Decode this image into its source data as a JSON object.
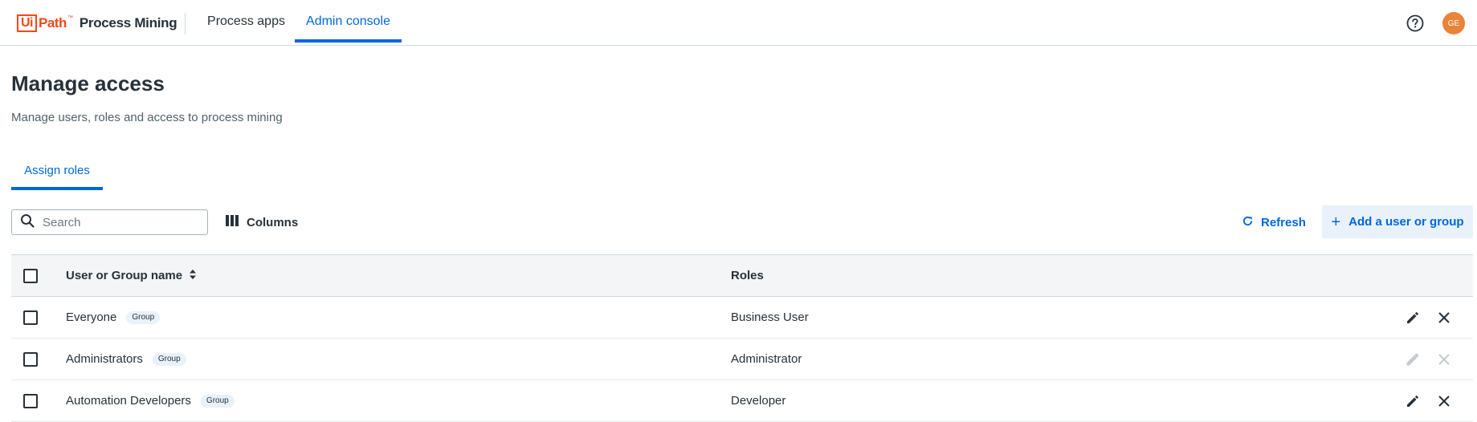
{
  "header": {
    "logo_mark": "Ui",
    "logo_path": "Path",
    "logo_tm": "™",
    "product_name": "Process Mining",
    "nav": [
      {
        "label": "Process apps",
        "active": false
      },
      {
        "label": "Admin console",
        "active": true
      }
    ],
    "help_icon": "help-circle-icon",
    "avatar_initials": "GE",
    "avatar_color": "#e8833a"
  },
  "page": {
    "title": "Manage access",
    "subtitle": "Manage users, roles and access to process mining"
  },
  "tabs": [
    {
      "label": "Assign roles",
      "active": true
    }
  ],
  "toolbar": {
    "search_placeholder": "Search",
    "columns_label": "Columns",
    "refresh_label": "Refresh",
    "add_label": "Add a user or group"
  },
  "table": {
    "headers": {
      "name": "User or Group name",
      "roles": "Roles"
    },
    "rows": [
      {
        "name": "Everyone",
        "badge": "Group",
        "role": "Business User",
        "actions_enabled": true
      },
      {
        "name": "Administrators",
        "badge": "Group",
        "role": "Administrator",
        "actions_enabled": false
      },
      {
        "name": "Automation Developers",
        "badge": "Group",
        "role": "Developer",
        "actions_enabled": true
      }
    ]
  },
  "colors": {
    "accent": "#0067df",
    "brand": "#fa4616"
  }
}
